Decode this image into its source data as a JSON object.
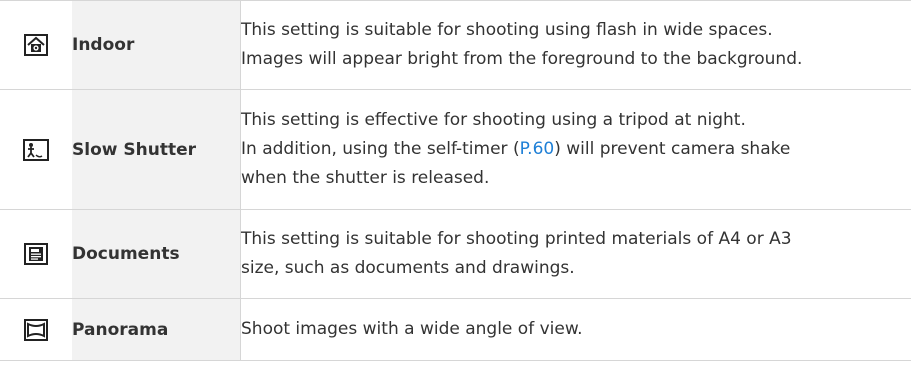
{
  "modes": [
    {
      "icon": "indoor-icon",
      "name": "Indoor",
      "lines": [
        "This setting is suitable for shooting using flash in wide spaces.",
        "Images will appear bright from the foreground to the background."
      ]
    },
    {
      "icon": "slow-shutter-icon",
      "name": "Slow Shutter",
      "lines": [
        "This setting is effective for shooting using a tripod at night.",
        "will prevent camera shake",
        "when the shutter is released."
      ],
      "inline_before": "In addition, using the self-timer (",
      "link": "P.60",
      "inline_after": ")"
    },
    {
      "icon": "documents-icon",
      "name": "Documents",
      "lines": [
        "This setting is suitable for shooting printed materials of A4 or A3",
        "size, such as documents and drawings."
      ]
    },
    {
      "icon": "panorama-icon",
      "name": "Panorama",
      "lines": [
        "Shoot images with a wide angle of view."
      ]
    }
  ],
  "colors": {
    "text": "#333333",
    "link": "#1e7fd6",
    "name_cell_bg": "#f2f2f2",
    "rule": "#d6d6d6"
  }
}
